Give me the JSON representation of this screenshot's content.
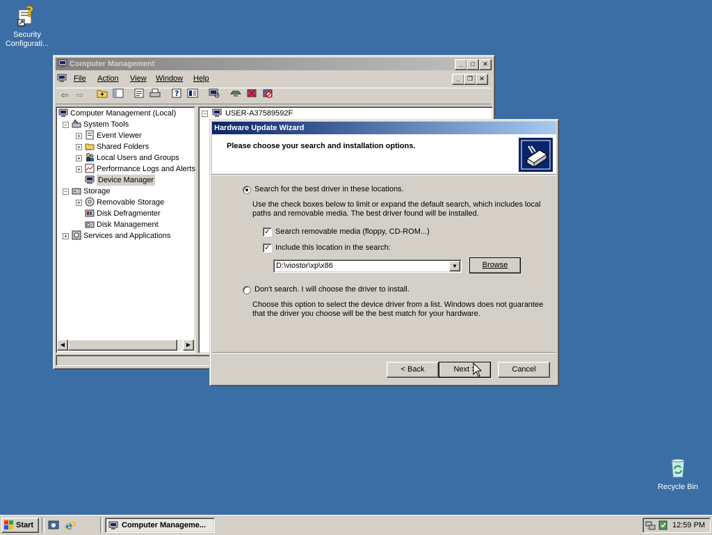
{
  "desktop": {
    "icons": [
      {
        "label": "Security\nConfigurati...",
        "icon": "security-config-icon"
      },
      {
        "label": "Recycle Bin",
        "icon": "recycle-bin-icon"
      }
    ]
  },
  "mmc": {
    "title": "Computer Management",
    "menu": [
      "File",
      "Action",
      "View",
      "Window",
      "Help"
    ],
    "menu_underline": [
      "F",
      "A",
      "V",
      "W",
      "H"
    ],
    "tree": [
      {
        "label": "Computer Management (Local)",
        "level": 0,
        "expander": "",
        "icon": "computer-icon"
      },
      {
        "label": "System Tools",
        "level": 1,
        "expander": "−",
        "icon": "tools-icon"
      },
      {
        "label": "Event Viewer",
        "level": 2,
        "expander": "+",
        "icon": "event-viewer-icon"
      },
      {
        "label": "Shared Folders",
        "level": 2,
        "expander": "+",
        "icon": "shared-folders-icon"
      },
      {
        "label": "Local Users and Groups",
        "level": 2,
        "expander": "+",
        "icon": "users-icon"
      },
      {
        "label": "Performance Logs and Alerts",
        "level": 2,
        "expander": "+",
        "icon": "performance-icon"
      },
      {
        "label": "Device Manager",
        "level": 2,
        "expander": "",
        "icon": "device-manager-icon",
        "selected": true
      },
      {
        "label": "Storage",
        "level": 1,
        "expander": "−",
        "icon": "storage-icon"
      },
      {
        "label": "Removable Storage",
        "level": 2,
        "expander": "+",
        "icon": "removable-storage-icon"
      },
      {
        "label": "Disk Defragmenter",
        "level": 2,
        "expander": "",
        "icon": "defrag-icon"
      },
      {
        "label": "Disk Management",
        "level": 2,
        "expander": "",
        "icon": "disk-mgmt-icon"
      },
      {
        "label": "Services and Applications",
        "level": 1,
        "expander": "+",
        "icon": "services-icon"
      }
    ],
    "right_root": "USER-A37589592F"
  },
  "wizard": {
    "title": "Hardware Update Wizard",
    "header": "Please choose your search and installation options.",
    "option1": {
      "label": "Search for the best driver in these locations.",
      "description": "Use the check boxes below to limit or expand the default search, which includes local paths and removable media. The best driver found will be installed.",
      "checked": true
    },
    "check1": {
      "label": "Search removable media (floppy, CD-ROM...)",
      "checked": true
    },
    "check2": {
      "label": "Include this location in the search:",
      "checked": true
    },
    "path": "D:\\viostor\\xp\\x86",
    "browse": "Browse",
    "option2": {
      "label": "Don't search. I will choose the driver to install.",
      "description": "Choose this option to select the device driver from a list.  Windows does not guarantee that the driver you choose will be the best match for your hardware.",
      "checked": false
    },
    "back": "< Back",
    "next": "Next >",
    "cancel": "Cancel"
  },
  "taskbar": {
    "start": "Start",
    "task": "Computer Manageme...",
    "clock": "12:59 PM"
  }
}
